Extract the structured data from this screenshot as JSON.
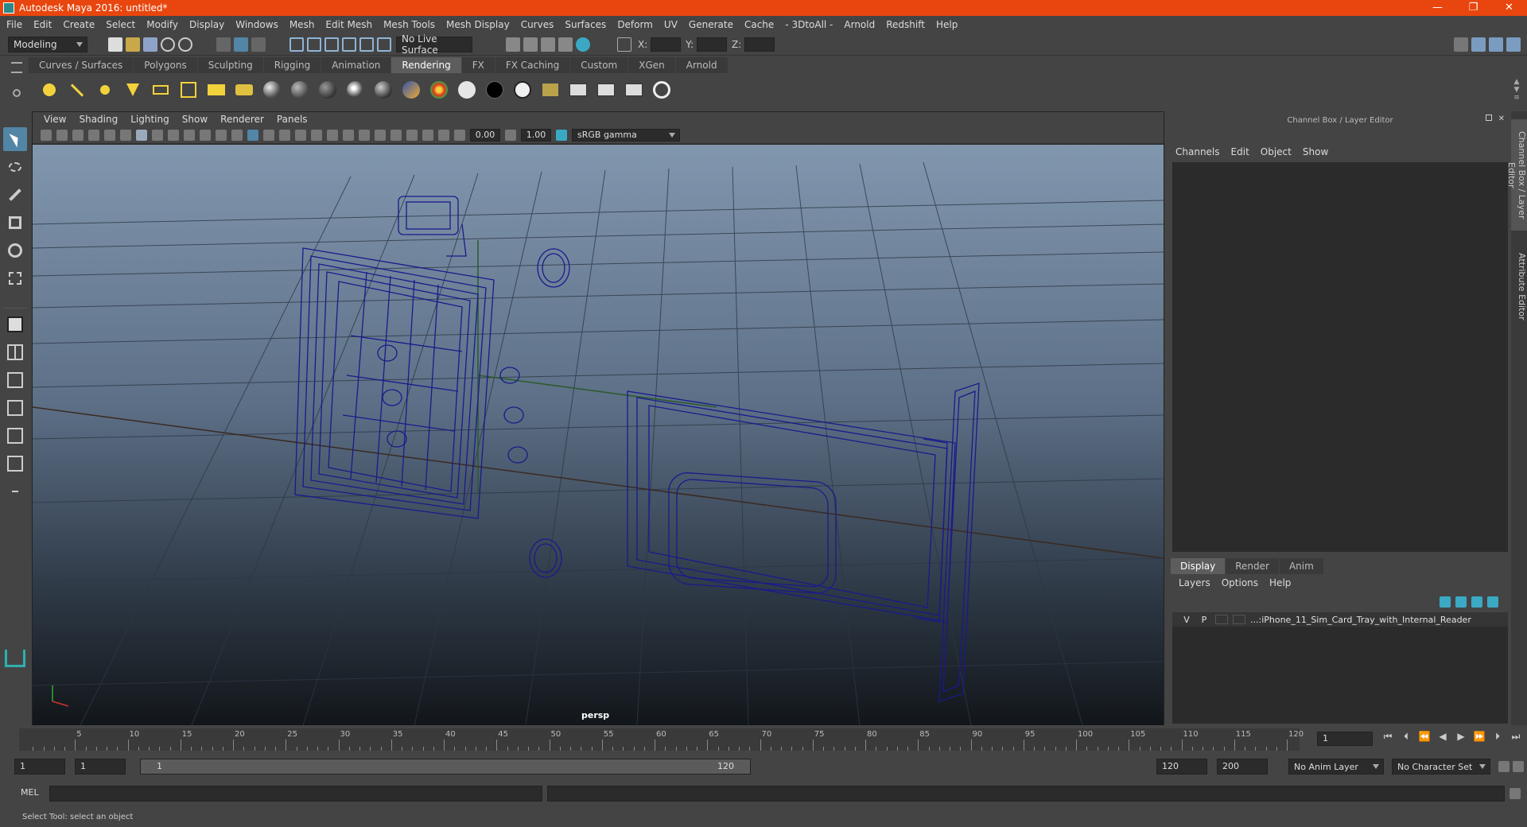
{
  "window": {
    "title": "Autodesk Maya 2016: untitled*",
    "minimize": "—",
    "restore": "❐",
    "close": "✕"
  },
  "menubar": [
    "File",
    "Edit",
    "Create",
    "Select",
    "Modify",
    "Display",
    "Windows",
    "Mesh",
    "Edit Mesh",
    "Mesh Tools",
    "Mesh Display",
    "Curves",
    "Surfaces",
    "Deform",
    "UV",
    "Generate",
    "Cache",
    "- 3DtoAll -",
    "Arnold",
    "Redshift",
    "Help"
  ],
  "statusline": {
    "mode": "Modeling",
    "live_surface": "No Live Surface",
    "x_label": "X:",
    "y_label": "Y:",
    "z_label": "Z:"
  },
  "shelf_tabs": [
    "Curves / Surfaces",
    "Polygons",
    "Sculpting",
    "Rigging",
    "Animation",
    "Rendering",
    "FX",
    "FX Caching",
    "Custom",
    "XGen",
    "Arnold"
  ],
  "shelf_active": "Rendering",
  "viewport": {
    "menu": [
      "View",
      "Shading",
      "Lighting",
      "Show",
      "Renderer",
      "Panels"
    ],
    "exposure": "0.00",
    "gamma": "1.00",
    "colorspace": "sRGB gamma",
    "camera": "persp"
  },
  "channelbox": {
    "title": "Channel Box / Layer Editor",
    "menu": [
      "Channels",
      "Edit",
      "Object",
      "Show"
    ]
  },
  "layer_editor": {
    "tabs": [
      "Display",
      "Render",
      "Anim"
    ],
    "active_tab": "Display",
    "menu": [
      "Layers",
      "Options",
      "Help"
    ],
    "layer": {
      "v": "V",
      "p": "P",
      "name": "...:iPhone_11_Sim_Card_Tray_with_Internal_Reader"
    }
  },
  "side_tabs": {
    "channel_box": "Channel Box / Layer Editor",
    "attribute_editor": "Attribute Editor"
  },
  "timeline": {
    "ticks": [
      5,
      10,
      15,
      20,
      25,
      30,
      35,
      40,
      45,
      50,
      55,
      60,
      65,
      70,
      75,
      80,
      85,
      90,
      95,
      100,
      105,
      110,
      115,
      120
    ],
    "start_label": "1",
    "current_frame": "1"
  },
  "range": {
    "start": "1",
    "playback_start": "1",
    "slider_start": "1",
    "slider_end": "120",
    "playback_end": "120",
    "end": "200",
    "anim_layer": "No Anim Layer",
    "character_set": "No Character Set"
  },
  "cmdline": {
    "label": "MEL"
  },
  "helpline": {
    "text": "Select Tool: select an object"
  },
  "colors": {
    "titlebar": "#e8460e",
    "wire": "#1a1a8c",
    "accent": "#5285a6"
  }
}
